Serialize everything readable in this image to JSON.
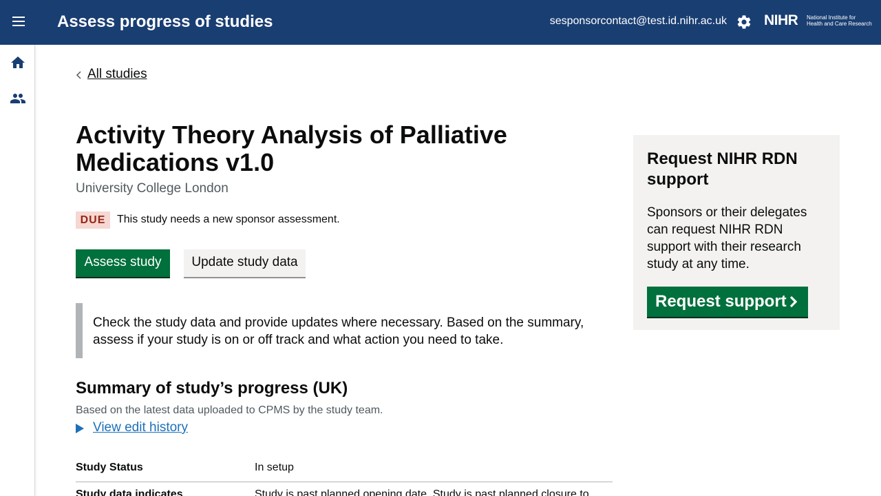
{
  "header": {
    "app_title": "Assess progress of studies",
    "user_email": "sesponsorcontact@test.id.nihr.ac.uk",
    "logo_text": "NIHR",
    "logo_org_line1": "National Institute for",
    "logo_org_line2": "Health and Care Research",
    "icons": [
      "menu-icon",
      "gear-icon"
    ]
  },
  "sidebar": {
    "items": [
      {
        "icon": "home-icon"
      },
      {
        "icon": "users-icon"
      }
    ]
  },
  "back_link": {
    "label": "All studies"
  },
  "study": {
    "title": "Activity Theory Analysis of Palliative Medications v1.0",
    "organisation": "University College London",
    "status_tag": "DUE",
    "status_message": "This study needs a new sponsor assessment."
  },
  "actions": {
    "assess_label": "Assess study",
    "update_label": "Update study data"
  },
  "inset_text": "Check the study data and provide updates where necessary. Based on the summary, assess if your study is on or off track and what action you need to take.",
  "summary": {
    "heading": "Summary of study’s progress (UK)",
    "subtext": "Based on the latest data uploaded to CPMS by the study team.",
    "history_link": "View edit history",
    "rows": [
      {
        "key": "Study Status",
        "value": "In setup"
      },
      {
        "key": "Study data indicates",
        "value": "Study is past planned opening date. Study is past planned closure to"
      }
    ]
  },
  "panel": {
    "heading": "Request NIHR RDN support",
    "body": "Sponsors or their delegates can request NIHR RDN support with their research study at any time.",
    "button_label": "Request support"
  },
  "colors": {
    "header_bg": "#193e72",
    "primary_green": "#00703c",
    "due_tag_bg": "#f6d7d2",
    "due_tag_text": "#942514",
    "link_blue": "#1d70b8"
  }
}
